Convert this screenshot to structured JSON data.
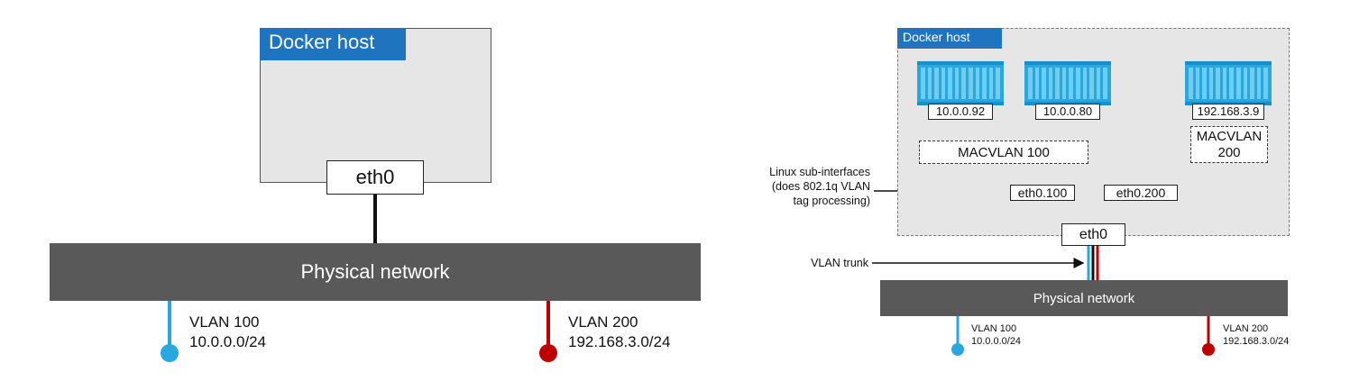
{
  "colors": {
    "host_tab": "#1f74bf",
    "network_bar": "#595959",
    "vlan100": "#29a8e0",
    "vlan200": "#c00000",
    "host_bg": "#e6e6e6"
  },
  "left": {
    "host_label": "Docker host",
    "eth0_label": "eth0",
    "network_label": "Physical network",
    "vlan100": {
      "name": "VLAN 100",
      "subnet": "10.0.0.0/24"
    },
    "vlan200": {
      "name": "VLAN 200",
      "subnet": "192.168.3.0/24"
    }
  },
  "right": {
    "host_label": "Docker host",
    "containers": [
      {
        "ip": "10.0.0.92",
        "icon": "container-icon"
      },
      {
        "ip": "10.0.0.80",
        "icon": "container-icon"
      },
      {
        "ip": "192.168.3.9",
        "icon": "container-icon"
      }
    ],
    "macvlan100_label": "MACVLAN 100",
    "macvlan200_label_line1": "MACVLAN",
    "macvlan200_label_line2": "200",
    "subif100_label": "eth0.100",
    "subif200_label": "eth0.200",
    "eth0_label": "eth0",
    "network_label": "Physical network",
    "annotation_subif": [
      "Linux sub-interfaces",
      "(does 802.1q VLAN",
      "tag processing)"
    ],
    "annotation_trunk": "VLAN trunk",
    "vlan100": {
      "name": "VLAN 100",
      "subnet": "10.0.0.0/24"
    },
    "vlan200": {
      "name": "VLAN 200",
      "subnet": "192.168.3.0/24"
    }
  }
}
